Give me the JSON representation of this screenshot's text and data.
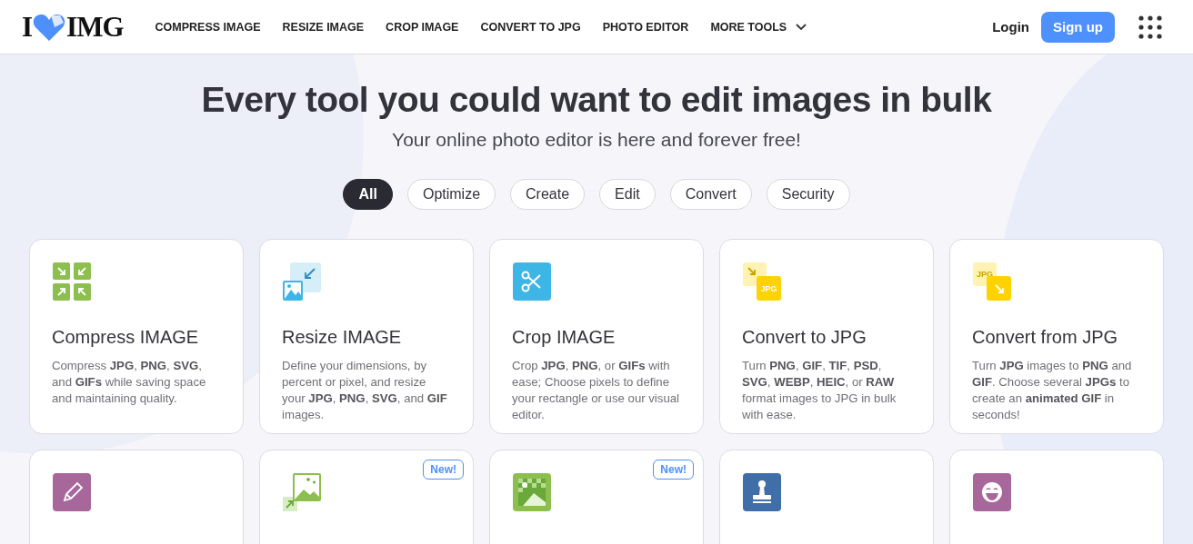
{
  "header": {
    "logo": {
      "left": "I",
      "right": "IMG"
    },
    "nav": [
      {
        "label": "COMPRESS IMAGE",
        "dropdown": false
      },
      {
        "label": "RESIZE IMAGE",
        "dropdown": false
      },
      {
        "label": "CROP IMAGE",
        "dropdown": false
      },
      {
        "label": "CONVERT TO JPG",
        "dropdown": false
      },
      {
        "label": "PHOTO EDITOR",
        "dropdown": false
      },
      {
        "label": "MORE TOOLS",
        "dropdown": true
      }
    ],
    "login": "Login",
    "signup": "Sign up"
  },
  "hero": {
    "title": "Every tool you could want to edit images in bulk",
    "subtitle": "Your online photo editor is here and forever free!"
  },
  "filters": [
    {
      "label": "All",
      "selected": true
    },
    {
      "label": "Optimize",
      "selected": false
    },
    {
      "label": "Create",
      "selected": false
    },
    {
      "label": "Edit",
      "selected": false
    },
    {
      "label": "Convert",
      "selected": false
    },
    {
      "label": "Security",
      "selected": false
    }
  ],
  "tools": [
    {
      "kind": "compress",
      "title": "Compress IMAGE",
      "description": "Compress **JPG**, **PNG**, **SVG**, and **GIFs** while saving space and maintaining quality."
    },
    {
      "kind": "resize",
      "title": "Resize IMAGE",
      "description": "Define your dimensions, by percent or pixel, and resize your **JPG**, **PNG**, **SVG**, and **GIF** images."
    },
    {
      "kind": "crop",
      "title": "Crop IMAGE",
      "description": "Crop **JPG**, **PNG**, or **GIFs** with ease; Choose pixels to define your rectangle or use our visual editor."
    },
    {
      "kind": "to-jpg",
      "icon_text": "JPG",
      "title": "Convert to JPG",
      "description": "Turn **PNG**, **GIF**, **TIF**, **PSD**, **SVG**, **WEBP**, **HEIC**, or **RAW** format images to JPG in bulk with ease."
    },
    {
      "kind": "from-jpg",
      "icon_text": "JPG",
      "title": "Convert from JPG",
      "description": "Turn **JPG** images to **PNG** and **GIF**. Choose several **JPGs** to create an **animated GIF** in seconds!"
    },
    {
      "kind": "editor"
    },
    {
      "kind": "upscale",
      "badge": "New!"
    },
    {
      "kind": "remove-bg",
      "badge": "New!"
    },
    {
      "kind": "watermark"
    },
    {
      "kind": "meme"
    }
  ]
}
